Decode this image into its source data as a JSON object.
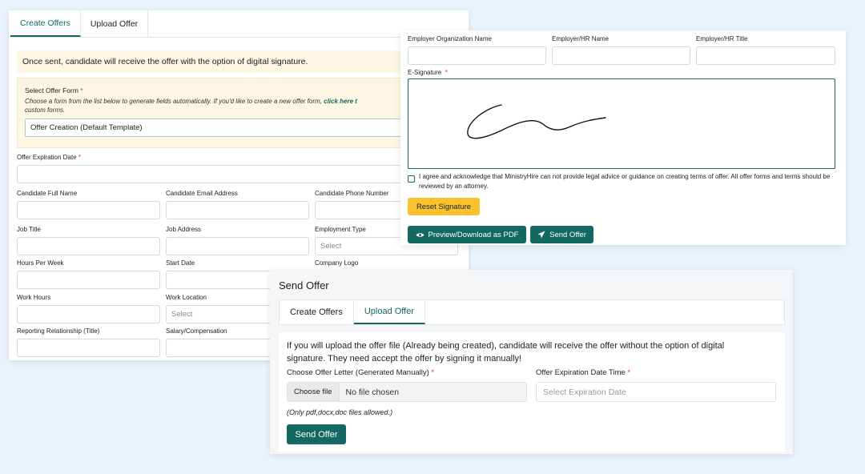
{
  "create_panel": {
    "tabs": [
      "Create Offers",
      "Upload Offer"
    ],
    "notice": "Once sent, candidate will receive the offer with the option of digital signature.",
    "offer_form": {
      "label": "Select Offer Form",
      "hint_text": "Choose a form from the list below to generate fields automatically. If you'd like to create a new offer form,",
      "hint_link": "click here t",
      "hint_tail": "custom forms.",
      "selected": "Offer Creation (Default Template)"
    },
    "fields": {
      "expiration": "Offer Expiration Date",
      "candidate_name": "Candidate Full Name",
      "candidate_email": "Candidate Email Address",
      "candidate_phone": "Candidate Phone Number",
      "job_title": "Job Title",
      "job_address": "Job Address",
      "employment_type": "Employment Type",
      "employment_type_placeholder": "Select",
      "hours_per_week": "Hours Per Week",
      "start_date": "Start Date",
      "company_logo": "Company Logo",
      "work_hours": "Work Hours",
      "work_location": "Work Location",
      "work_location_placeholder": "Select",
      "reporting": "Reporting Relationship (Title)",
      "salary": "Salary/Compensation"
    }
  },
  "employer_panel": {
    "org_name": "Employer Organization Name",
    "hr_name": "Employer/HR Name",
    "hr_title": "Employer/HR Title",
    "esignature": "E-Signature",
    "agree_text": "I agree and acknowledge that MinistryHire can not provide legal advice or guidance on creating terms of offer. All offer forms and terms should be reviewed by an attorney.",
    "reset_label": "Reset Signature",
    "preview_label": "Preview/Download as PDF",
    "send_label": "Send Offer",
    "colors": {
      "primary": "#136862",
      "reset": "#f9c22e"
    }
  },
  "upload_panel": {
    "title": "Send Offer",
    "tabs": [
      "Create Offers",
      "Upload Offer"
    ],
    "message": "If you will upload the offer file (Already being created), candidate will receive the offer without the option of digital signature. They need accept the offer by signing it manually!",
    "file_label": "Choose Offer Letter (Generated Manually)",
    "file_button": "Choose file",
    "file_status": "No file chosen",
    "date_label": "Offer Expiration Date Time",
    "date_placeholder": "Select Expiration Date",
    "note": "(Only pdf,docx,doc files allowed.)",
    "send_label": "Send Offer"
  }
}
